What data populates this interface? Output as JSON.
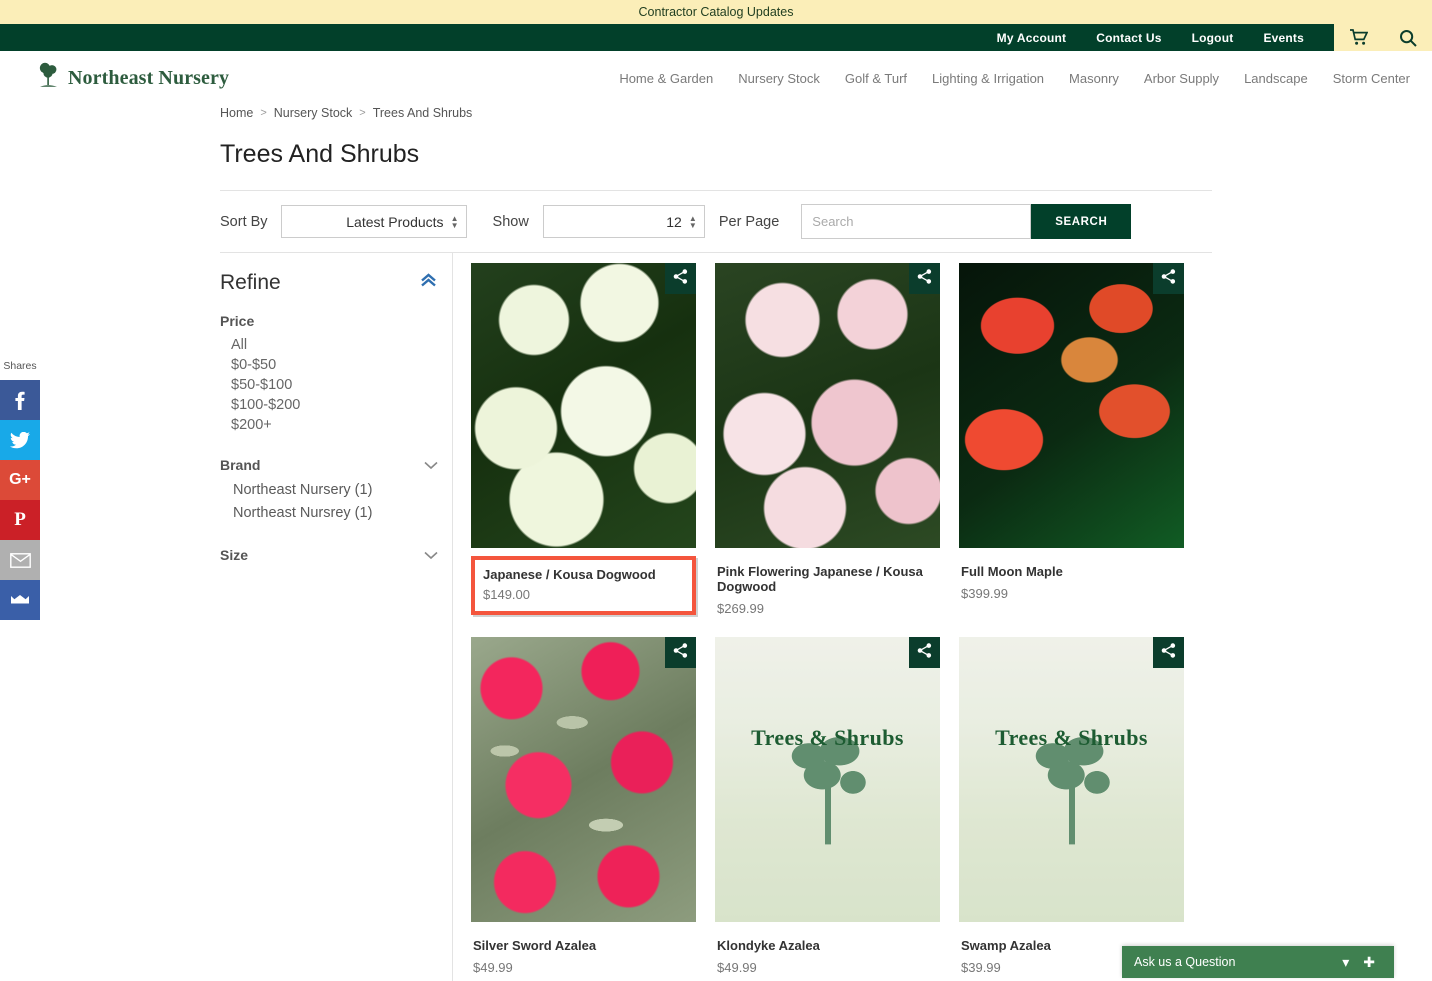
{
  "banner": {
    "text": "Contractor Catalog Updates"
  },
  "utility": {
    "links": [
      "My Account",
      "Contact Us",
      "Logout",
      "Events"
    ],
    "cart_icon": "shopping-cart-icon",
    "search_icon": "search-icon"
  },
  "brand": {
    "name": "Northeast Nursery",
    "logo_icon": "tree-logo-icon"
  },
  "nav": {
    "items": [
      "Home & Garden",
      "Nursery Stock",
      "Golf & Turf",
      "Lighting & Irrigation",
      "Masonry",
      "Arbor Supply",
      "Landscape",
      "Storm Center"
    ]
  },
  "share_rail": {
    "label": "Shares",
    "buttons": [
      "facebook-share",
      "twitter-share",
      "googleplus-share",
      "pinterest-share",
      "email-share",
      "flipboard-share"
    ]
  },
  "breadcrumb": {
    "items": [
      "Home",
      "Nursery Stock",
      "Trees And Shrubs"
    ],
    "separator": ">"
  },
  "page": {
    "title": "Trees And Shrubs"
  },
  "toolbar": {
    "sort_label": "Sort By",
    "sort_value": "Latest Products",
    "show_label": "Show",
    "show_value": "12",
    "per_page_label": "Per Page",
    "search_placeholder": "Search",
    "search_value": "",
    "search_button": "SEARCH"
  },
  "refine": {
    "title": "Refine",
    "collapse_icon": "chevron-up-icon",
    "facets": [
      {
        "name": "Price",
        "expanded": true,
        "options": [
          "All",
          "$0-$50",
          "$50-$100",
          "$100-$200",
          "$200+"
        ]
      },
      {
        "name": "Brand",
        "expanded": true,
        "chevron": "chevron-down-icon",
        "options": [
          "Northeast Nursery (1)",
          "Northeast Nursrey (1)"
        ]
      },
      {
        "name": "Size",
        "expanded": false,
        "chevron": "chevron-down-icon",
        "options": []
      }
    ]
  },
  "products": [
    {
      "name": "Japanese / Kousa Dogwood",
      "price": "$149.00",
      "art": "art-dogwood-white",
      "highlighted": true,
      "placeholder_text": ""
    },
    {
      "name": "Pink Flowering Japanese / Kousa Dogwood",
      "price": "$269.99",
      "art": "art-dogwood-pink",
      "highlighted": false,
      "placeholder_text": ""
    },
    {
      "name": "Full Moon Maple",
      "price": "$399.99",
      "art": "art-maple",
      "highlighted": false,
      "placeholder_text": ""
    },
    {
      "name": "Silver Sword Azalea",
      "price": "$49.99",
      "art": "art-azalea-pink",
      "highlighted": false,
      "placeholder_text": ""
    },
    {
      "name": "Klondyke Azalea",
      "price": "$49.99",
      "art": "art-placeholder",
      "highlighted": false,
      "placeholder_text": "Trees & Shrubs"
    },
    {
      "name": "Swamp Azalea",
      "price": "$39.99",
      "art": "art-placeholder",
      "highlighted": false,
      "placeholder_text": "Trees & Shrubs"
    }
  ],
  "product_share_icon": "share-icon",
  "chat": {
    "label": "Ask us a Question",
    "collapse_icon": "chevron-down-icon",
    "expand_icon": "plus-icon"
  },
  "colors": {
    "banner_bg": "#fbeeb8",
    "nav_bg": "#02402a",
    "accent_green": "#3f8050",
    "highlight_border": "#f4553d",
    "logo_green": "#2d5c3e"
  }
}
